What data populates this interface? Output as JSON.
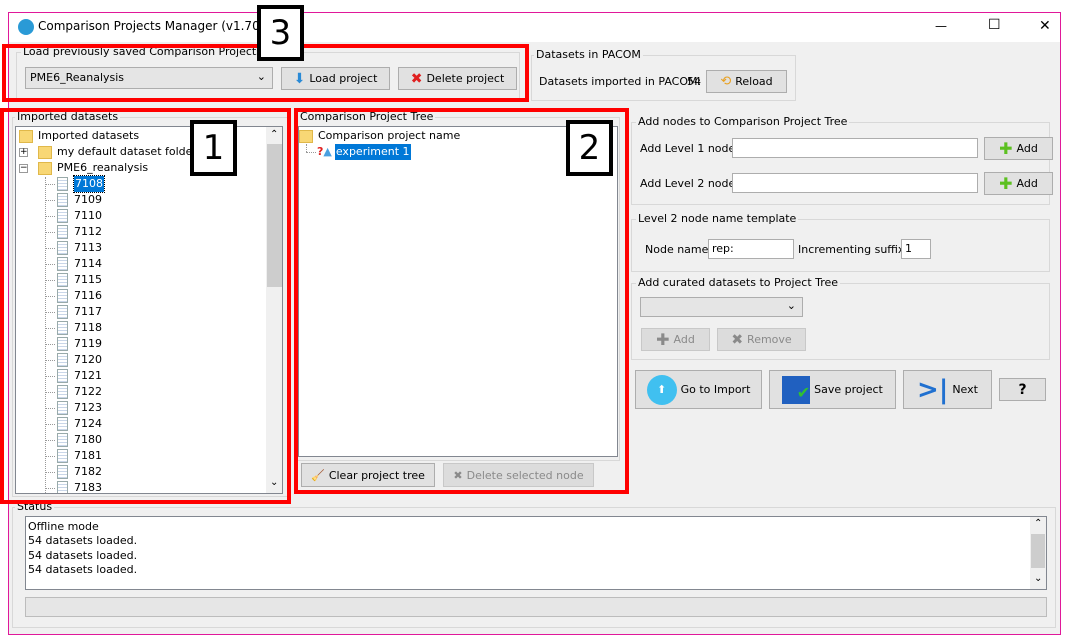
{
  "window": {
    "title": "Comparison Projects Manager (v1.70)",
    "minimize": "—",
    "maximize": "☐",
    "close": "✕"
  },
  "load_group": {
    "label": "Load previously saved Comparison Projects",
    "selected_project": "PME6_Reanalysis",
    "load_button": "Load project",
    "delete_button": "Delete project"
  },
  "pacom_group": {
    "label": "Datasets in PACOM",
    "text": "Datasets imported in PACOM:",
    "count": "54",
    "reload_button": "Reload"
  },
  "imported": {
    "label": "Imported datasets",
    "root": "Imported datasets",
    "folders": [
      "my default dataset folder",
      "PME6_reanalysis"
    ],
    "datasets": [
      "7108",
      "7109",
      "7110",
      "7112",
      "7113",
      "7114",
      "7115",
      "7116",
      "7117",
      "7118",
      "7119",
      "7120",
      "7121",
      "7122",
      "7123",
      "7124",
      "7180",
      "7181",
      "7182",
      "7183"
    ],
    "selected": "7108"
  },
  "project_tree": {
    "label": "Comparison Project Tree",
    "root": "Comparison project name",
    "nodes": [
      "experiment 1"
    ],
    "clear_button": "Clear project tree",
    "delete_node_button": "Delete selected node"
  },
  "add_nodes": {
    "label": "Add nodes to Comparison Project Tree",
    "level1_label": "Add Level 1 node:",
    "level1_value": "",
    "level2_label": "Add Level 2 node:",
    "level2_value": "",
    "add_button": "Add"
  },
  "template": {
    "label": "Level 2 node name template",
    "node_name_label": "Node name:",
    "node_name_value": "rep:",
    "suffix_label": "Incrementing suffix:",
    "suffix_value": "1"
  },
  "curated": {
    "label": "Add curated datasets to Project Tree",
    "selected": "",
    "add_button": "Add",
    "remove_button": "Remove"
  },
  "actions": {
    "import_button": "Go to Import",
    "save_button": "Save project",
    "next_button": "Next",
    "help_button": "?"
  },
  "status": {
    "label": "Status",
    "lines": [
      "Offline mode",
      "54 datasets loaded.",
      "54 datasets loaded.",
      "54 datasets loaded."
    ],
    "progress": 0
  },
  "annotations": [
    "1",
    "2",
    "3"
  ],
  "colors": {
    "selection": "#0078d7",
    "highlight_box": "#ff0000",
    "window_border": "#e0189a"
  }
}
